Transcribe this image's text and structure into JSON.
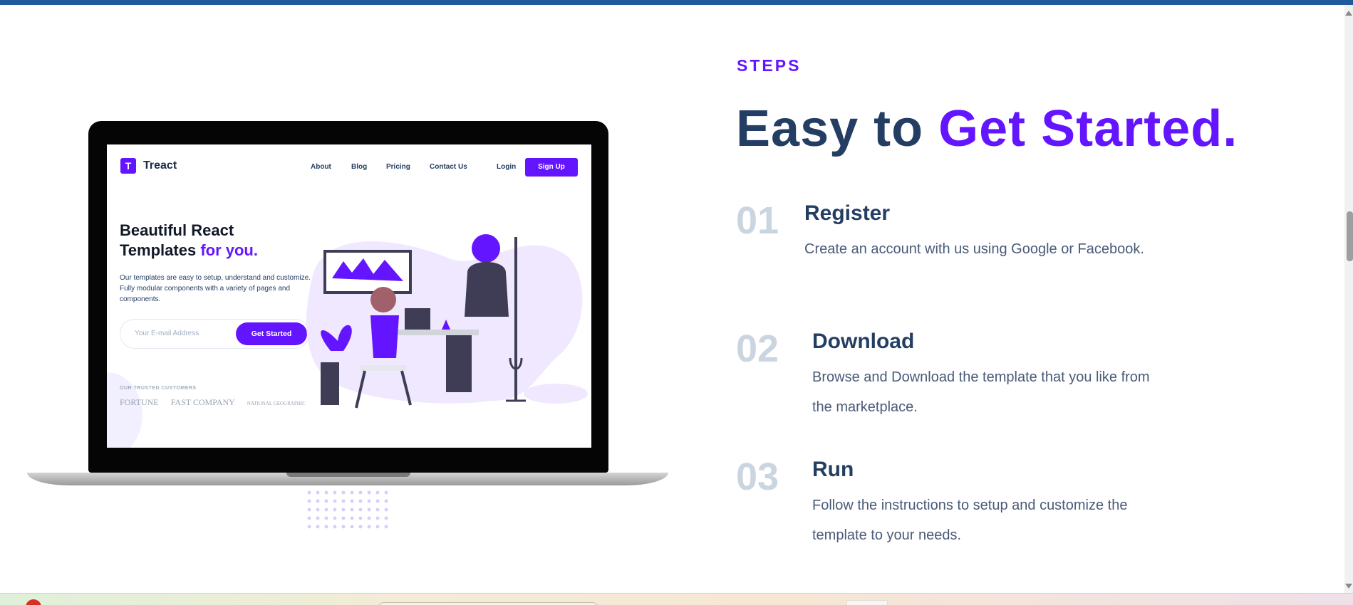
{
  "preview": {
    "brand": "Treact",
    "logo_letter": "T",
    "nav": [
      "About",
      "Blog",
      "Pricing",
      "Contact Us"
    ],
    "login": "Login",
    "signup": "Sign Up",
    "headline_part1": "Beautiful React Templates ",
    "headline_accent": "for you.",
    "description": "Our templates are easy to setup, understand and customize. Fully modular components with a variety of pages and components.",
    "email_placeholder": "Your E-mail Address",
    "cta": "Get Started",
    "trusted_label": "OUR TRUSTED CUSTOMERS",
    "customer_logos": [
      "FORTUNE",
      "FAST COMPANY",
      "NATIONAL GEOGRAPHIC"
    ]
  },
  "section": {
    "subheading": "STEPS",
    "heading_part1": "Easy to ",
    "heading_accent": "Get Started."
  },
  "steps": [
    {
      "number": "01",
      "title": "Register",
      "description": "Create an account with us using Google or Facebook."
    },
    {
      "number": "02",
      "title": "Download",
      "description": "Browse and Download the template that you like from the marketplace."
    },
    {
      "number": "03",
      "title": "Run",
      "description": "Follow the instructions to setup and customize the template to your needs."
    }
  ],
  "colors": {
    "primary": "#6415ff",
    "heading": "#243e63",
    "step_number": "#cbd5e0",
    "top_bar": "#1e5a9c"
  }
}
